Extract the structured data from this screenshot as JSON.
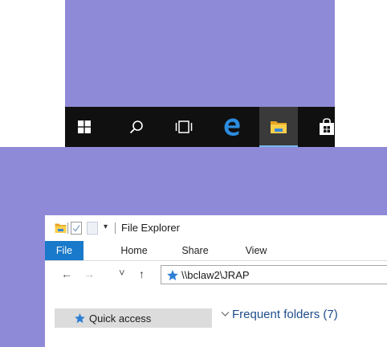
{
  "colors": {
    "desktop": "#8f8ad8",
    "taskbar": "#101010",
    "accent": "#1979ca",
    "folder_heading": "#1e4e8c"
  },
  "taskbar": {
    "buttons": [
      {
        "name": "start-button",
        "icon": "windows-logo-icon",
        "active": false
      },
      {
        "name": "search-button",
        "icon": "search-icon",
        "active": false
      },
      {
        "name": "task-view-button",
        "icon": "task-view-icon",
        "active": false
      },
      {
        "name": "edge-button",
        "icon": "edge-icon",
        "active": false
      },
      {
        "name": "file-explorer-button",
        "icon": "folder-icon",
        "active": true
      },
      {
        "name": "store-button",
        "icon": "store-icon",
        "active": false
      }
    ]
  },
  "explorer": {
    "title": "File Explorer",
    "quick_access_dropdown": "▾",
    "ribbon_tabs": [
      {
        "label": "File",
        "selected": true
      },
      {
        "label": "Home",
        "selected": false
      },
      {
        "label": "Share",
        "selected": false
      },
      {
        "label": "View",
        "selected": false
      }
    ],
    "nav": {
      "back": "←",
      "forward": "→",
      "recent": "˅",
      "up": "↑"
    },
    "address": "\\\\bclaw2\\JRAP",
    "navpane": {
      "quick_access_label": "Quick access"
    },
    "content": {
      "section_heading": "Frequent folders (7)"
    }
  }
}
